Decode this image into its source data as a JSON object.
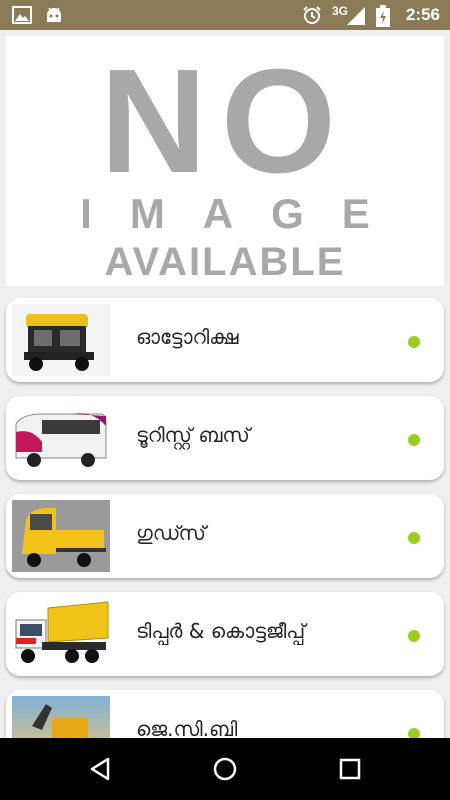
{
  "status_bar": {
    "network": "3G",
    "time": "2:56",
    "icons": [
      "image-notification-icon",
      "android-notification-icon",
      "alarm-icon",
      "signal-icon",
      "battery-icon"
    ]
  },
  "hero": {
    "line1": "NO",
    "line2": "IMAGE",
    "line3": "AVAILABLE"
  },
  "items": [
    {
      "label": "ഓട്ടോറിക്ഷ",
      "icon": "autorickshaw-thumbnail"
    },
    {
      "label": "ടൂറിസ്റ്റ് ബസ്",
      "icon": "tourist-bus-thumbnail"
    },
    {
      "label": "ഗുഡ്സ്",
      "icon": "goods-vehicle-thumbnail"
    },
    {
      "label": "ടിപ്പർ & കൊട്ടജീപ്പ്",
      "icon": "tipper-truck-thumbnail"
    },
    {
      "label": "ജെ.സി.ബി",
      "icon": "jcb-thumbnail"
    }
  ],
  "colors": {
    "status_bar": "#8a7a55",
    "dot": "#9ccc1e",
    "background": "#efefef"
  },
  "nav": [
    "back-icon",
    "home-icon",
    "recents-icon"
  ]
}
